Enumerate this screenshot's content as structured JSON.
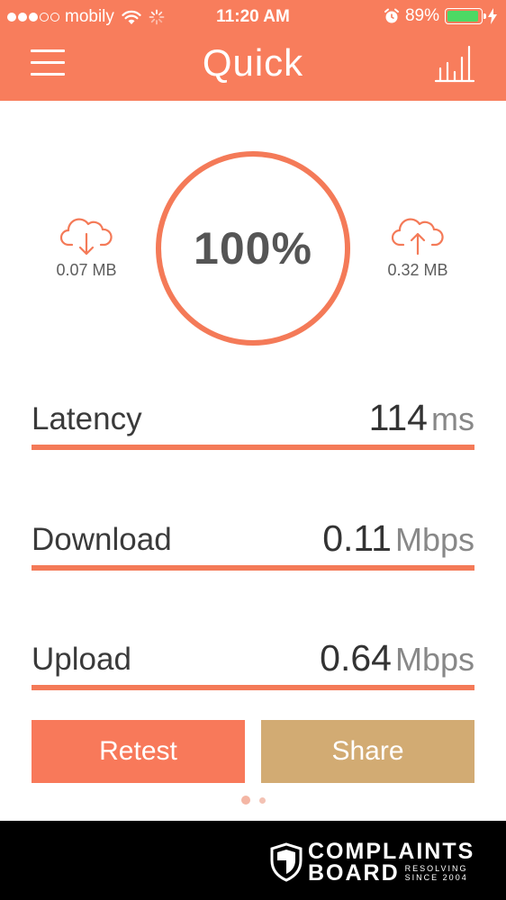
{
  "status_bar": {
    "carrier": "mobily",
    "time": "11:20 AM",
    "battery": "89%",
    "battery_level": 0.89,
    "signal_bars_filled": 3,
    "signal_bars_total": 5
  },
  "nav": {
    "title": "Quick",
    "menu_icon": "hamburger-menu-icon",
    "stats_icon": "bar-chart-icon"
  },
  "gauge": {
    "value": "100%",
    "progress": 1.0
  },
  "transfer": {
    "download_amount": "0.07 MB",
    "upload_amount": "0.32 MB",
    "download_icon": "cloud-download-icon",
    "upload_icon": "cloud-upload-icon"
  },
  "metrics": [
    {
      "label": "Latency",
      "value": "114",
      "unit": "ms"
    },
    {
      "label": "Download",
      "value": "0.11",
      "unit": "Mbps"
    },
    {
      "label": "Upload",
      "value": "0.64",
      "unit": "Mbps"
    }
  ],
  "buttons": {
    "retest": "Retest",
    "share": "Share"
  },
  "pager": {
    "pages": 2,
    "active": 0
  },
  "watermark": {
    "line1": "COMPLAINTS",
    "line2": "BOARD",
    "tag1": "RESOLVING",
    "tag2": "SINCE 2004"
  },
  "colors": {
    "accent": "#f87d5c",
    "share": "#d2ab73",
    "battery": "#4cd964"
  }
}
